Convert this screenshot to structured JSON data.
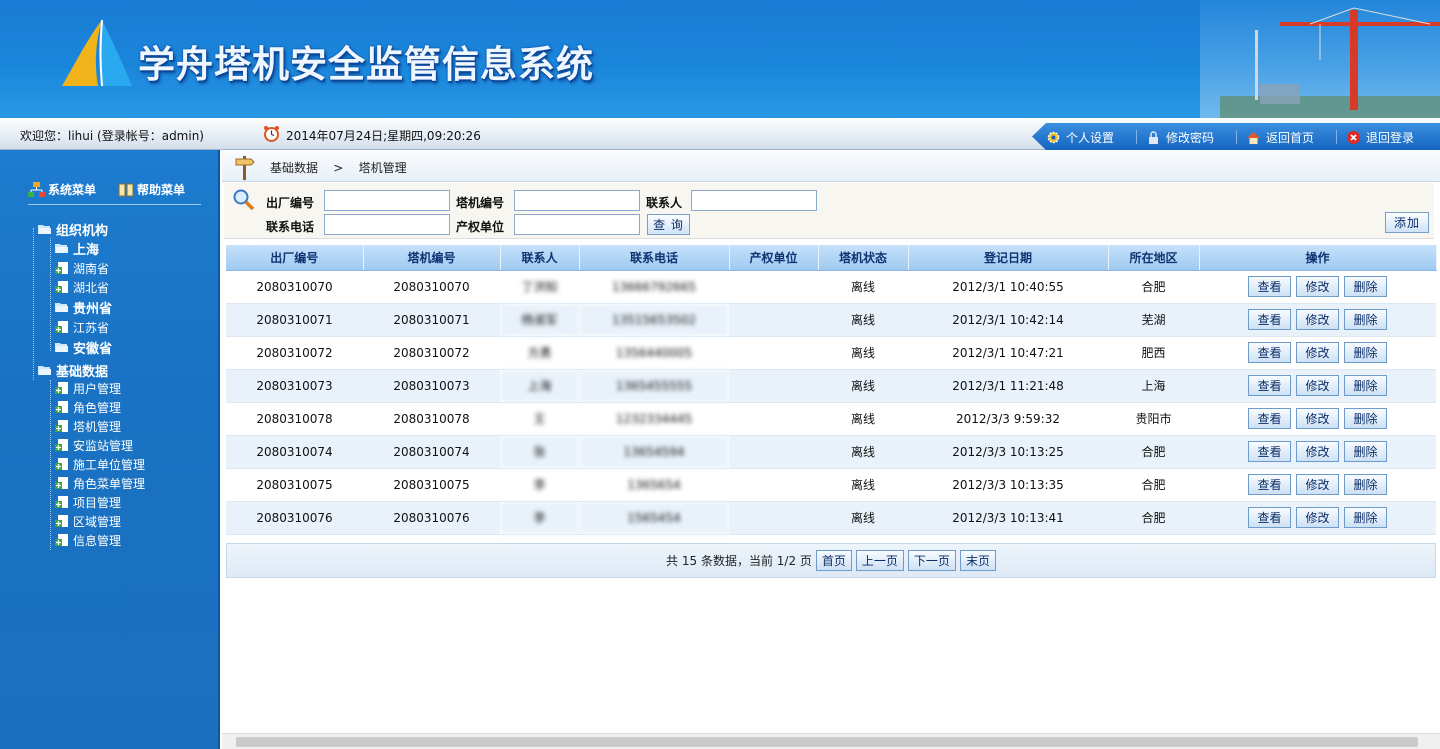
{
  "app": {
    "title": "学舟塔机安全监管信息系统"
  },
  "header": {
    "welcome": "欢迎您：lihui (登录帐号：admin)",
    "datetime": "2014年07月24日;星期四,09:20:26",
    "nav": [
      {
        "label": "个人设置",
        "icon": "gear-icon"
      },
      {
        "label": "修改密码",
        "icon": "lock-icon"
      },
      {
        "label": "返回首页",
        "icon": "home-icon"
      },
      {
        "label": "退回登录",
        "icon": "exit-icon"
      }
    ]
  },
  "sidebar": {
    "tabs": [
      {
        "label": "系统菜单"
      },
      {
        "label": "帮助菜单"
      }
    ],
    "tree": [
      {
        "label": "组织机构",
        "bold": true,
        "children": [
          {
            "label": "上海",
            "bold": true
          },
          {
            "label": "湖南省"
          },
          {
            "label": "湖北省"
          },
          {
            "label": "贵州省",
            "bold": true
          },
          {
            "label": "江苏省"
          },
          {
            "label": "安徽省",
            "bold": true
          }
        ]
      },
      {
        "label": "基础数据",
        "bold": true,
        "children": [
          {
            "label": "用户管理"
          },
          {
            "label": "角色管理"
          },
          {
            "label": "塔机管理"
          },
          {
            "label": "安监站管理"
          },
          {
            "label": "施工单位管理"
          },
          {
            "label": "角色菜单管理"
          },
          {
            "label": "项目管理"
          },
          {
            "label": "区域管理"
          },
          {
            "label": "信息管理"
          }
        ]
      }
    ]
  },
  "breadcrumb": {
    "text": "基础数据    >    塔机管理"
  },
  "search": {
    "factory_no_label": "出厂编号",
    "crane_no_label": "塔机编号",
    "contact_label": "联系人",
    "phone_label": "联系电话",
    "owner_label": "产权单位",
    "query_button": "查 询",
    "add_button": "添加"
  },
  "table": {
    "columns": [
      "出厂编号",
      "塔机编号",
      "联系人",
      "联系电话",
      "产权单位",
      "塔机状态",
      "登记日期",
      "所在地区",
      "操作"
    ],
    "rows": [
      {
        "factory_no": "2080310070",
        "crane_no": "2080310070",
        "contact": "丁洪知",
        "phone": "13666792665",
        "owner": "",
        "status": "离线",
        "date": "2012/3/1 10:40:55",
        "region": "合肥"
      },
      {
        "factory_no": "2080310071",
        "crane_no": "2080310071",
        "contact": "杨淑军",
        "phone": "13515653502",
        "owner": "",
        "status": "离线",
        "date": "2012/3/1 10:42:14",
        "region": "芜湖"
      },
      {
        "factory_no": "2080310072",
        "crane_no": "2080310072",
        "contact": "方勇",
        "phone": "1356440005",
        "owner": "",
        "status": "离线",
        "date": "2012/3/1 10:47:21",
        "region": "肥西"
      },
      {
        "factory_no": "2080310073",
        "crane_no": "2080310073",
        "contact": "上海",
        "phone": "1365455555",
        "owner": "",
        "status": "离线",
        "date": "2012/3/1 11:21:48",
        "region": "上海"
      },
      {
        "factory_no": "2080310078",
        "crane_no": "2080310078",
        "contact": "王",
        "phone": "1232334445",
        "owner": "",
        "status": "离线",
        "date": "2012/3/3 9:59:32",
        "region": "贵阳市"
      },
      {
        "factory_no": "2080310074",
        "crane_no": "2080310074",
        "contact": "张",
        "phone": "13654594",
        "owner": "",
        "status": "离线",
        "date": "2012/3/3 10:13:25",
        "region": "合肥"
      },
      {
        "factory_no": "2080310075",
        "crane_no": "2080310075",
        "contact": "李",
        "phone": "1365654",
        "owner": "",
        "status": "离线",
        "date": "2012/3/3 10:13:35",
        "region": "合肥"
      },
      {
        "factory_no": "2080310076",
        "crane_no": "2080310076",
        "contact": "李",
        "phone": "1565454",
        "owner": "",
        "status": "离线",
        "date": "2012/3/3 10:13:41",
        "region": "合肥"
      }
    ],
    "actions": [
      "查看",
      "修改",
      "删除"
    ]
  },
  "pager": {
    "summary": "共 15 条数据，当前 1/2 页",
    "first": "首页",
    "prev": "上一页",
    "next": "下一页",
    "last": "末页"
  },
  "colors": {
    "brand": "#1a7cd4",
    "header_accent": "#1565c0",
    "sidebar": "#1b74c6"
  }
}
